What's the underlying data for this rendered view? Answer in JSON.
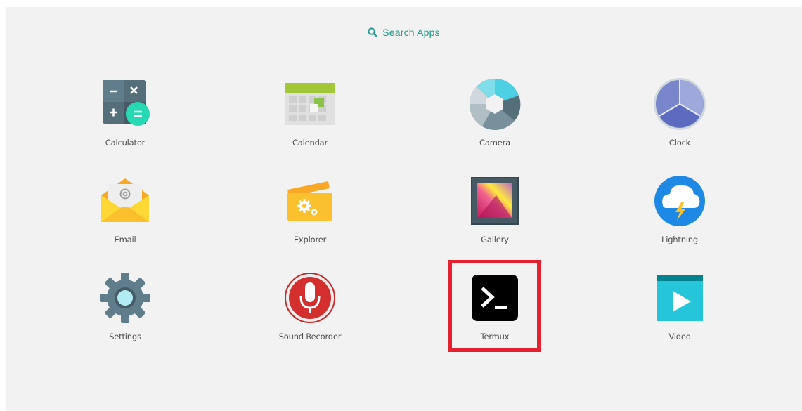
{
  "search": {
    "label": "Search Apps",
    "icon": "search-icon",
    "color": "#1e9b88"
  },
  "apps": [
    {
      "label": "Calculator",
      "icon": "calculator-icon"
    },
    {
      "label": "Calendar",
      "icon": "calendar-icon"
    },
    {
      "label": "Camera",
      "icon": "camera-icon"
    },
    {
      "label": "Clock",
      "icon": "clock-icon"
    },
    {
      "label": "Email",
      "icon": "email-icon"
    },
    {
      "label": "Explorer",
      "icon": "explorer-icon"
    },
    {
      "label": "Gallery",
      "icon": "gallery-icon"
    },
    {
      "label": "Lightning",
      "icon": "lightning-icon"
    },
    {
      "label": "Settings",
      "icon": "settings-icon"
    },
    {
      "label": "Sound Recorder",
      "icon": "sound-recorder-icon"
    },
    {
      "label": "Termux",
      "icon": "termux-icon"
    },
    {
      "label": "Video",
      "icon": "video-icon"
    }
  ],
  "highlight": {
    "target": "Termux",
    "color": "#e3212f"
  }
}
